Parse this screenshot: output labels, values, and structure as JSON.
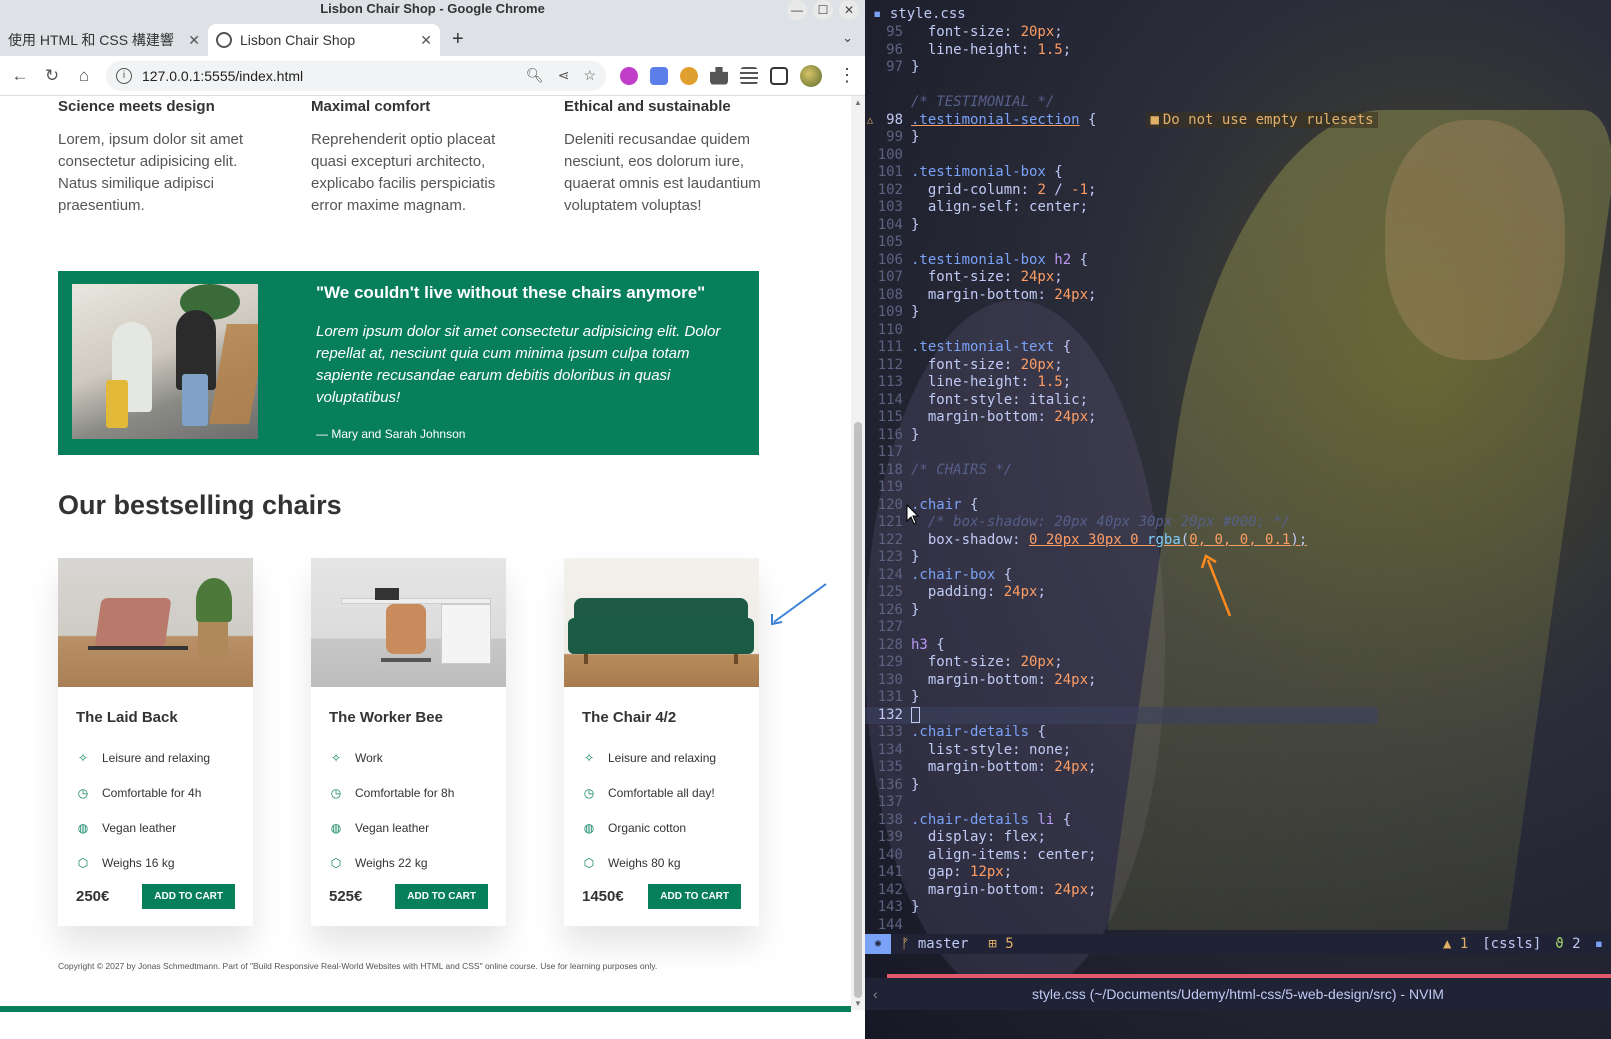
{
  "window": {
    "title": "Lisbon Chair Shop - Google Chrome",
    "min_glyph": "—",
    "max_glyph": "☐",
    "close_glyph": "✕"
  },
  "tabs": [
    {
      "label": "使用 HTML 和 CSS 構建響",
      "close": "✕"
    },
    {
      "label": "Lisbon Chair Shop",
      "close": "✕"
    }
  ],
  "newtab": "+",
  "tabmenu": "⌄",
  "address": {
    "url": "127.0.0.1:5555/index.html",
    "back": "←",
    "forward": "→",
    "reload": "↻",
    "home": "⌂",
    "info": "i",
    "zoom": "🔍︎",
    "share": "⋖",
    "star": "☆",
    "menu": "⋮"
  },
  "colors": {
    "brand": "#087f5b",
    "editor_bg": "#1a1b26",
    "warning": "#e0af68"
  },
  "features": [
    {
      "title": "Science meets design",
      "text": "Lorem, ipsum dolor sit amet consectetur adipisicing elit. Natus similique adipisci praesentium."
    },
    {
      "title": "Maximal comfort",
      "text": "Reprehenderit optio placeat quasi excepturi architecto, explicabo facilis perspiciatis error maxime magnam."
    },
    {
      "title": "Ethical and sustainable",
      "text": "Deleniti recusandae quidem nesciunt, eos dolorum iure, quaerat omnis est laudantium voluptatem voluptas!"
    }
  ],
  "testimonial": {
    "quote": "\"We couldn't live without these chairs anymore\"",
    "text": "Lorem ipsum dolor sit amet consectetur adipisicing elit. Dolor repellat at, nesciunt quia cum minima ipsum culpa totam sapiente recusandae earum debitis doloribus in quasi voluptatibus!",
    "author": "— Mary and Sarah Johnson"
  },
  "bestsellers_heading": "Our bestselling chairs",
  "chairs": [
    {
      "name": "The Laid Back",
      "details": [
        "Leisure and relaxing",
        "Comfortable for 4h",
        "Vegan leather",
        "Weighs 16 kg"
      ],
      "price": "250€",
      "button": "ADD TO CART"
    },
    {
      "name": "The Worker Bee",
      "details": [
        "Work",
        "Comfortable for 8h",
        "Vegan leather",
        "Weighs 22 kg"
      ],
      "price": "525€",
      "button": "ADD TO CART"
    },
    {
      "name": "The Chair 4/2",
      "details": [
        "Leisure and relaxing",
        "Comfortable all day!",
        "Organic cotton",
        "Weighs 80 kg"
      ],
      "price": "1450€",
      "button": "ADD TO CART"
    }
  ],
  "detail_icons": [
    "sparkles-icon",
    "clock-icon",
    "leaf-icon",
    "cube-icon"
  ],
  "footer": "Copyright © 2027 by Jonas Schmedtmann. Part of \"Build Responsive Real-World Websites with HTML and CSS\" online course. Use for learning purposes only.",
  "editor": {
    "filename": "style.css",
    "diagnostic": "Do not use empty rulesets",
    "statusline": {
      "branch": "master",
      "changes": "5",
      "warnings": "1",
      "filetype": "[cssls]",
      "ls_count": "2"
    },
    "cmdline": "style.css (~/Documents/Udemy/html-css/5-web-design/src) - NVIM"
  }
}
